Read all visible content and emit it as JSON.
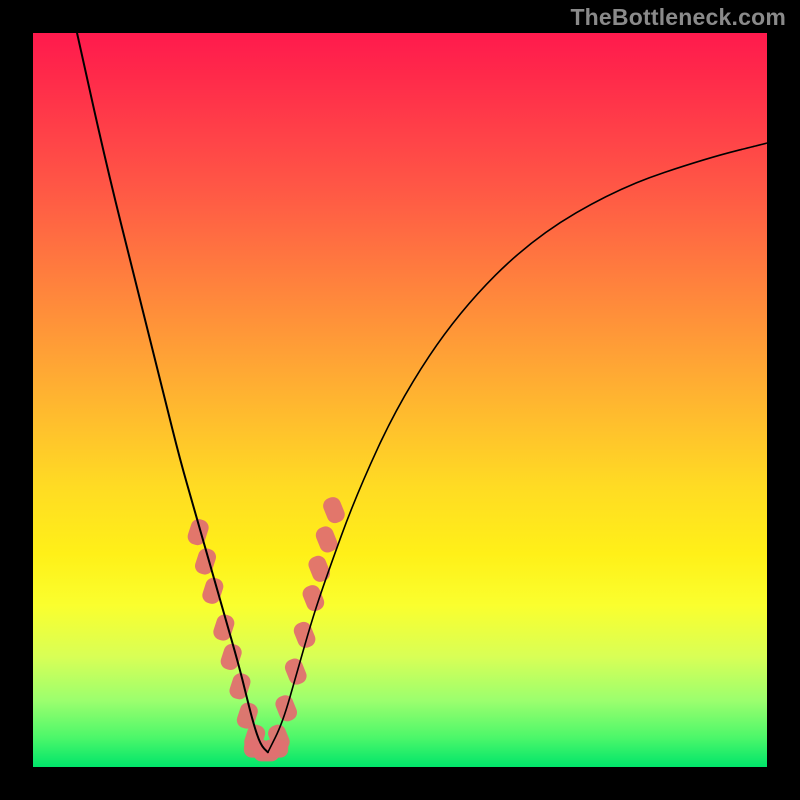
{
  "watermark": "TheBottleneck.com",
  "colors": {
    "frame": "#000000",
    "gradient_top": "#ff1a4d",
    "gradient_bottom": "#00e56a",
    "curve": "#000000",
    "blob": "#e07070",
    "watermark": "#8a8a8a"
  },
  "chart_data": {
    "type": "line",
    "title": "",
    "xlabel": "",
    "ylabel": "",
    "xlim": [
      0,
      100
    ],
    "ylim": [
      0,
      100
    ],
    "grid": false,
    "notes": "No numeric axes or tick labels are rendered. Values are estimated from pixel positions; x normalized 0–100 left→right, y normalized 0–100 bottom→top. Two black curves form a V shape with minimum near x≈31. Salmon blobs cluster along both curve arms near the bottom.",
    "series": [
      {
        "name": "left-arm",
        "x": [
          6,
          10,
          14,
          18,
          20,
          22,
          24,
          26,
          28,
          29,
          30,
          31,
          32
        ],
        "y": [
          100,
          82,
          66,
          50,
          42,
          35,
          28,
          21,
          14,
          10,
          6,
          3,
          2
        ]
      },
      {
        "name": "right-arm",
        "x": [
          32,
          34,
          36,
          38,
          40,
          44,
          50,
          58,
          68,
          80,
          92,
          100
        ],
        "y": [
          2,
          6,
          13,
          20,
          26,
          37,
          50,
          62,
          72,
          79,
          83,
          85
        ]
      }
    ],
    "blobs_left_arm": [
      {
        "x": 22.5,
        "y": 32
      },
      {
        "x": 23.5,
        "y": 28
      },
      {
        "x": 24.5,
        "y": 24
      },
      {
        "x": 26.0,
        "y": 19
      },
      {
        "x": 27.0,
        "y": 15
      },
      {
        "x": 28.2,
        "y": 11
      },
      {
        "x": 29.2,
        "y": 7
      },
      {
        "x": 30.2,
        "y": 4
      }
    ],
    "blobs_right_arm": [
      {
        "x": 33.5,
        "y": 4
      },
      {
        "x": 34.5,
        "y": 8
      },
      {
        "x": 35.8,
        "y": 13
      },
      {
        "x": 37.0,
        "y": 18
      },
      {
        "x": 38.2,
        "y": 23
      },
      {
        "x": 39.0,
        "y": 27
      },
      {
        "x": 40.0,
        "y": 31
      },
      {
        "x": 41.0,
        "y": 35
      }
    ],
    "blobs_bottom": [
      {
        "x": 30.5,
        "y": 2.5
      },
      {
        "x": 31.8,
        "y": 2.0
      },
      {
        "x": 33.0,
        "y": 2.5
      }
    ]
  }
}
